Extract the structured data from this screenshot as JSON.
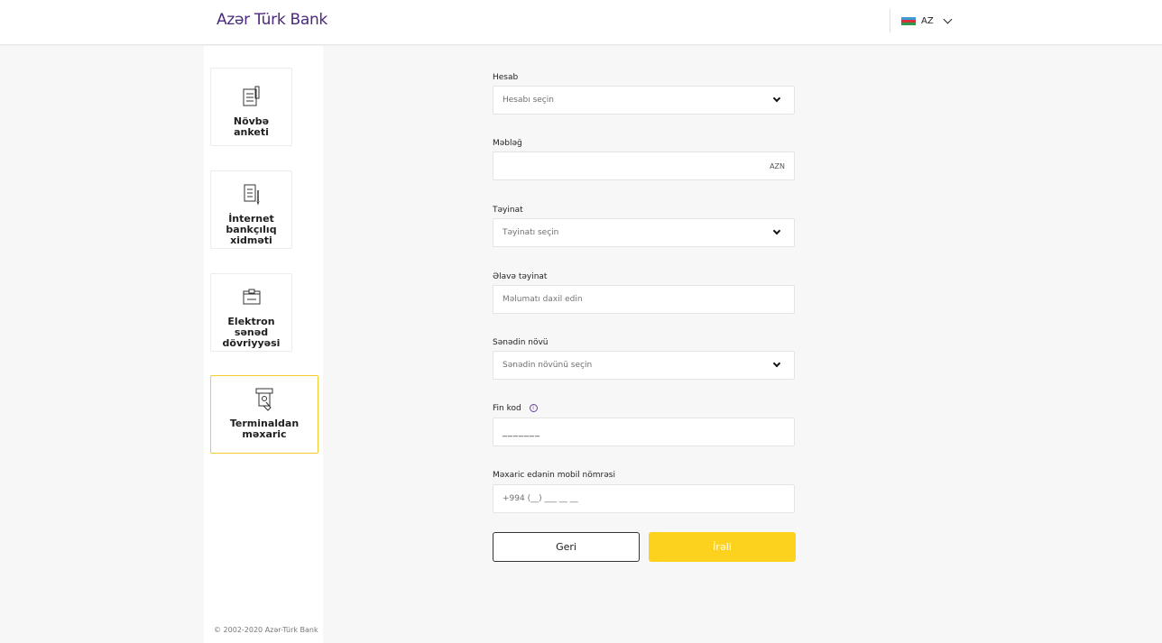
{
  "header": {
    "logo": "Azər Türk Bank",
    "language": "AZ",
    "flag_colors": [
      "#3f9bd6",
      "#d6323a",
      "#2e9a4b"
    ]
  },
  "sidebar": {
    "items": [
      {
        "label": "Növbə anketi",
        "icon": "form-icon",
        "active": false
      },
      {
        "label": "İnternet bankçılıq xidməti",
        "icon": "document-pen-icon",
        "active": false
      },
      {
        "label": "Elektron sənəd dövriyyəsi",
        "icon": "card-reader-icon",
        "active": false
      },
      {
        "label": "Terminaldan məxaric",
        "icon": "atm-withdraw-icon",
        "active": true
      }
    ],
    "copyright": "© 2002-2020 Azər-Türk Bank"
  },
  "form": {
    "account": {
      "label": "Hesab",
      "placeholder": "Hesabı seçin"
    },
    "amount": {
      "label": "Məbləğ",
      "value": "",
      "suffix": "AZN"
    },
    "purpose": {
      "label": "Təyinat",
      "placeholder": "Təyinatı seçin"
    },
    "extra_purpose": {
      "label": "Əlavə təyinat",
      "placeholder": "Məlumatı daxil edin"
    },
    "doc_type": {
      "label": "Sənədin növü",
      "placeholder": "Sənədin növünü seçin"
    },
    "fin_code": {
      "label": "Fin kod",
      "value": "_______"
    },
    "mobile": {
      "label": "Məxaric edənin mobil nömrəsi",
      "value": "+994 (__) ___ __ __"
    },
    "back_label": "Geri",
    "next_label": "İrəli"
  },
  "colors": {
    "accent": "#fcd21e",
    "brand": "#4a2a7a",
    "active_border": "#f2cc2d"
  }
}
